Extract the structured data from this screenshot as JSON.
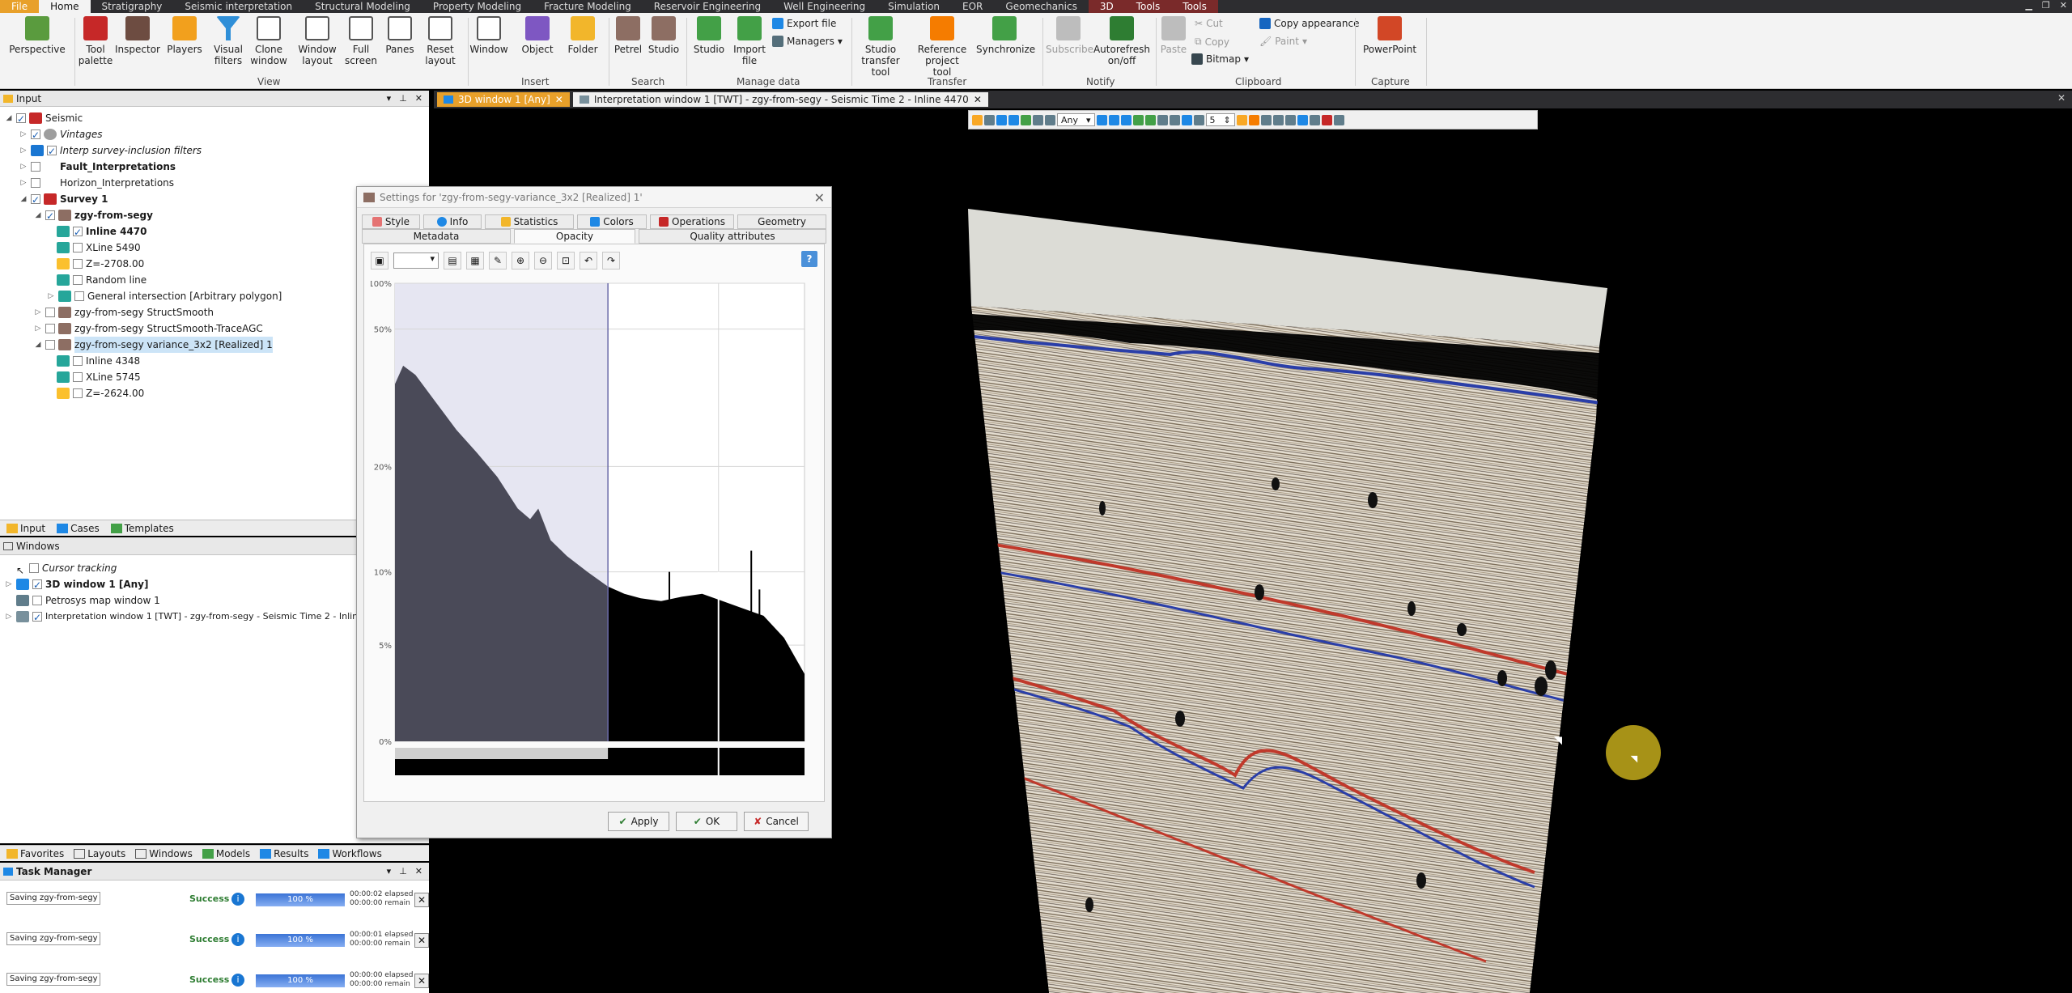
{
  "ribbon_tabs": [
    "File",
    "Home",
    "Stratigraphy",
    "Seismic interpretation",
    "Structural Modeling",
    "Property Modeling",
    "Fracture Modeling",
    "Reservoir Engineering",
    "Well Engineering",
    "Simulation",
    "EOR",
    "Geomechanics",
    "3D",
    "Tools",
    "Tools"
  ],
  "ribbon": {
    "perspective": "Perspective",
    "tool_palette": "Tool palette",
    "inspector": "Inspector",
    "players": "Players",
    "visual_filters": "Visual filters",
    "clone_window": "Clone window",
    "window_layout": "Window layout",
    "full_screen": "Full screen",
    "panes": "Panes",
    "reset_layout": "Reset layout",
    "window": "Window",
    "object": "Object",
    "folder": "Folder",
    "petrel": "Petrel",
    "studio_search": "Studio",
    "studio": "Studio",
    "import_file": "Import file",
    "export_file": "Export file",
    "managers": "Managers",
    "studio_transfer": "Studio transfer tool",
    "reference_project": "Reference project tool",
    "synchronize": "Synchronize",
    "subscribe": "Subscribe",
    "autorefresh": "Autorefresh on/off",
    "paste": "Paste",
    "cut": "Cut",
    "copy": "Copy",
    "bitmap": "Bitmap",
    "copy_appearance": "Copy appearance",
    "paint": "Paint",
    "powerpoint": "PowerPoint",
    "groups": {
      "view": "View",
      "insert": "Insert",
      "search": "Search",
      "manage_data": "Manage data",
      "transfer": "Transfer",
      "notify": "Notify",
      "clipboard": "Clipboard",
      "capture": "Capture"
    }
  },
  "input_pane": {
    "title": "Input",
    "tree": [
      "Seismic",
      "Vintages",
      "Interp survey-inclusion filters",
      "Fault_Interpretations",
      "Horizon_Interpretations",
      "Survey 1",
      "zgy-from-segy",
      "Inline 4470",
      "XLine 5490",
      "Z=-2708.00",
      "Random line",
      "General intersection [Arbitrary polygon]",
      "zgy-from-segy StructSmooth",
      "zgy-from-segy StructSmooth-TraceAGC",
      "zgy-from-segy variance_3x2 [Realized] 1",
      "Inline 4348",
      "XLine 5745",
      "Z=-2624.00"
    ]
  },
  "bottom_tabs1": [
    "Input",
    "Cases",
    "Templates"
  ],
  "windows_pane": {
    "title": "Windows",
    "items": [
      "Cursor tracking",
      "3D window 1 [Any]",
      "Petrosys map window 1",
      "Interpretation window 1 [TWT] - zgy-from-segy - Seismic Time 2 - Inline 4470"
    ]
  },
  "bottom_tabs2": [
    "Favorites",
    "Layouts",
    "Windows",
    "Models",
    "Results",
    "Workflows"
  ],
  "task_manager": {
    "title": "Task Manager",
    "tasks": [
      {
        "name": "Saving zgy-from-segy vari",
        "status": "Success",
        "progress": "100 %",
        "elapsed": "00:00:02 elapsed",
        "remain": "00:00:00 remain"
      },
      {
        "name": "Saving zgy-from-segy Stru",
        "status": "Success",
        "progress": "100 %",
        "elapsed": "00:00:01 elapsed",
        "remain": "00:00:00 remain"
      },
      {
        "name": "Saving zgy-from-segy [Str",
        "status": "Success",
        "progress": "100 %",
        "elapsed": "00:00:00 elapsed",
        "remain": "00:00:00 remain"
      }
    ]
  },
  "doc_tabs": [
    "3D window 1 [Any]",
    "Interpretation window 1 [TWT] - zgy-from-segy - Seismic Time 2 - Inline 4470"
  ],
  "toolbar3d": {
    "select_value": "Any",
    "spin_value": "5"
  },
  "settings_dialog": {
    "title": "Settings for 'zgy-from-segy-variance_3x2 [Realized] 1'",
    "tabs_row1": [
      "Style",
      "Info",
      "Statistics",
      "Colors",
      "Operations",
      "Geometry"
    ],
    "tabs_row2": [
      "Metadata",
      "Opacity",
      "Quality attributes"
    ],
    "active_tab": "Opacity",
    "help": "?",
    "buttons": {
      "apply": "Apply",
      "ok": "OK",
      "cancel": "Cancel"
    }
  },
  "chart_data": {
    "type": "area",
    "title": "",
    "xlabel": "",
    "ylabel": "",
    "yticks": [
      "100%",
      "50%",
      "20%",
      "10%",
      "5%",
      "0%"
    ],
    "ylim": [
      0,
      100
    ],
    "scale": "log-like",
    "opacity_cutoff_fraction": 0.52,
    "histogram_shape_percent": [
      [
        0.0,
        38
      ],
      [
        0.02,
        42
      ],
      [
        0.05,
        40
      ],
      [
        0.1,
        34
      ],
      [
        0.15,
        28
      ],
      [
        0.2,
        23
      ],
      [
        0.25,
        19
      ],
      [
        0.3,
        16
      ],
      [
        0.33,
        15
      ],
      [
        0.35,
        16
      ],
      [
        0.38,
        13
      ],
      [
        0.42,
        11.5
      ],
      [
        0.47,
        10
      ],
      [
        0.52,
        9
      ],
      [
        0.56,
        8.5
      ],
      [
        0.6,
        8.2
      ],
      [
        0.65,
        8
      ],
      [
        0.7,
        8.3
      ],
      [
        0.75,
        8.5
      ],
      [
        0.8,
        8
      ],
      [
        0.85,
        7.5
      ],
      [
        0.9,
        7
      ],
      [
        0.95,
        5.5
      ],
      [
        1.0,
        3.5
      ]
    ],
    "spikes_percent": [
      [
        0.67,
        10
      ],
      [
        0.87,
        12
      ],
      [
        0.89,
        8.8
      ]
    ],
    "colors": {
      "opaque_fill": "#4a4a58",
      "transparent_fill": "#000000",
      "selection": "#e6e6f2"
    }
  },
  "colors": {
    "accent": "#e8a02a",
    "ribbon": "#f3f3f3",
    "dark": "#2d2d30"
  }
}
